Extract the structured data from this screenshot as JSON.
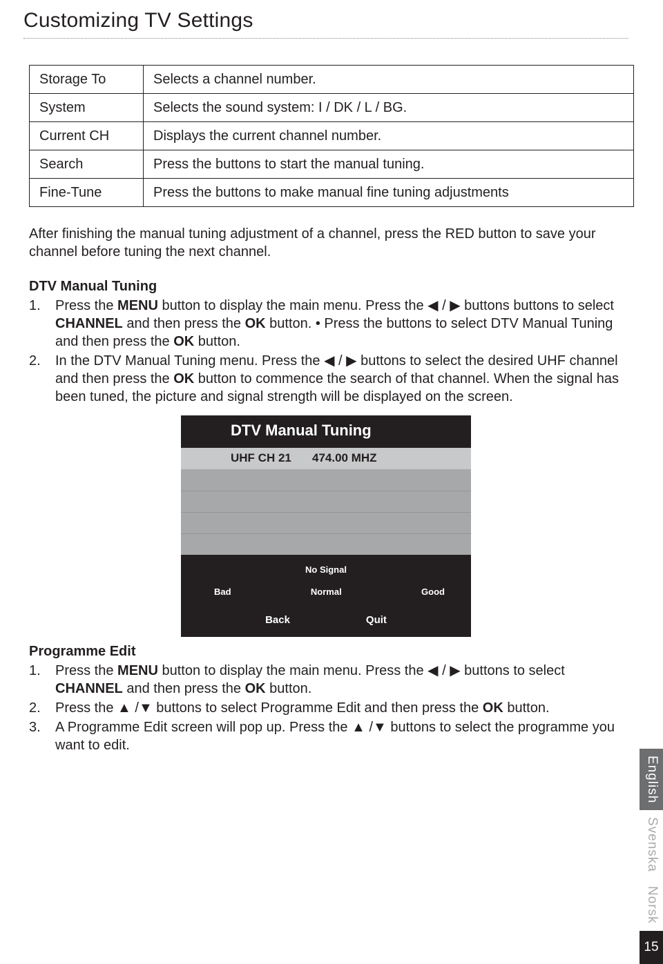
{
  "title": "Customizing TV Settings",
  "table": [
    {
      "k": "Storage To",
      "v": "Selects a channel number."
    },
    {
      "k": "System",
      "v": "Selects the sound system: I / DK / L / BG."
    },
    {
      "k": "Current CH",
      "v": "Displays the current channel number."
    },
    {
      "k": "Search",
      "v": "Press the buttons to start the manual tuning."
    },
    {
      "k": "Fine-Tune",
      "v": "Press the buttons to make manual fine tuning adjustments"
    }
  ],
  "after_para": "After finishing the manual tuning adjustment of a channel, press the RED button to save your channel before tuning the next channel.",
  "dtv": {
    "head": "DTV Manual Tuning",
    "s1a": "Press the ",
    "menu": "MENU",
    "s1b": " button to display the main menu. Press the ",
    "lr": "◀ / ▶",
    "s1c": " buttons buttons to select ",
    "channel": "CHANNEL",
    "s1d": " and then press the ",
    "ok": "OK",
    "s1e": " button. • Press the buttons to select DTV Manual Tuning and then press the ",
    "s1f": " button.",
    "s2a": "In the DTV Manual Tuning menu. Press the ",
    "s2b": " buttons to select the desired UHF channel and then press the ",
    "s2c": " button to commence the search of that channel. When the signal has been tuned, the picture and signal strength will be displayed on the screen."
  },
  "osd": {
    "title": "DTV Manual Tuning",
    "ch": "UHF CH 21",
    "freq": "474.00 MHZ",
    "nosig": "No Signal",
    "bad": "Bad",
    "normal": "Normal",
    "good": "Good",
    "back": "Back",
    "quit": "Quit"
  },
  "pe": {
    "head": "Programme Edit",
    "s1a": "Press the ",
    "s1b": " button to display the main menu. Press the ",
    "s1c": " buttons to select ",
    "s1d": " and then press the ",
    "s1e": " button.",
    "s2a": "Press the ",
    "ud": "▲ /▼",
    "s2b": "  buttons to select Programme Edit and then press the ",
    "s2c": " button.",
    "s3a": "A Programme Edit screen will pop up. Press the  ",
    "s3b": " buttons to select the programme you want to edit."
  },
  "langs": {
    "en": "English",
    "sv": "Svenska",
    "no": "Norsk"
  },
  "page_number": "15"
}
